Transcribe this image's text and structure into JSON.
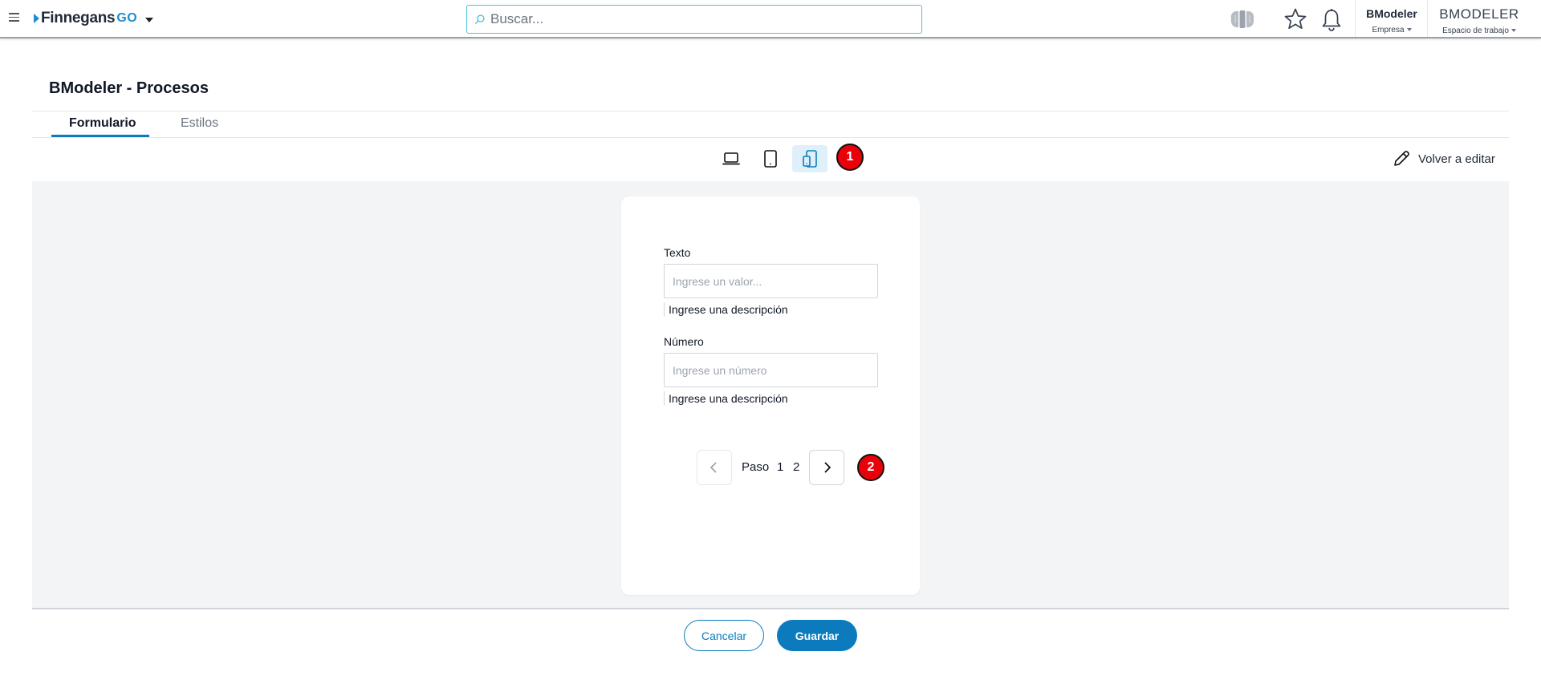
{
  "header": {
    "logo_text": "Finnegans",
    "logo_go": "GO",
    "search_placeholder": "Buscar...",
    "company": {
      "name": "BModeler",
      "label": "Empresa"
    },
    "workspace": {
      "name": "BMODELER",
      "label": "Espacio de trabajo"
    }
  },
  "page": {
    "title": "BModeler - Procesos",
    "tabs": [
      {
        "label": "Formulario",
        "active": true
      },
      {
        "label": "Estilos",
        "active": false
      }
    ]
  },
  "toolbar": {
    "devices": [
      {
        "icon": "laptop-icon",
        "active": false
      },
      {
        "icon": "tablet-icon",
        "active": false
      },
      {
        "icon": "mobile-icon",
        "active": true
      }
    ],
    "badge_1": "1",
    "edit_label": "Volver a editar"
  },
  "form": {
    "fields": [
      {
        "label": "Texto",
        "placeholder": "Ingrese un valor...",
        "description": "Ingrese una descripción"
      },
      {
        "label": "Número",
        "placeholder": "Ingrese un número",
        "description": "Ingrese una descripción"
      }
    ],
    "pager": {
      "label": "Paso",
      "pages": [
        "1",
        "2"
      ],
      "badge_2": "2"
    }
  },
  "footer": {
    "cancel_label": "Cancelar",
    "save_label": "Guardar"
  },
  "colors": {
    "accent": "#0b7bbd",
    "search_border": "#4dc3d8",
    "badge": "#e8000b",
    "canvas_bg": "#f3f4f6"
  }
}
